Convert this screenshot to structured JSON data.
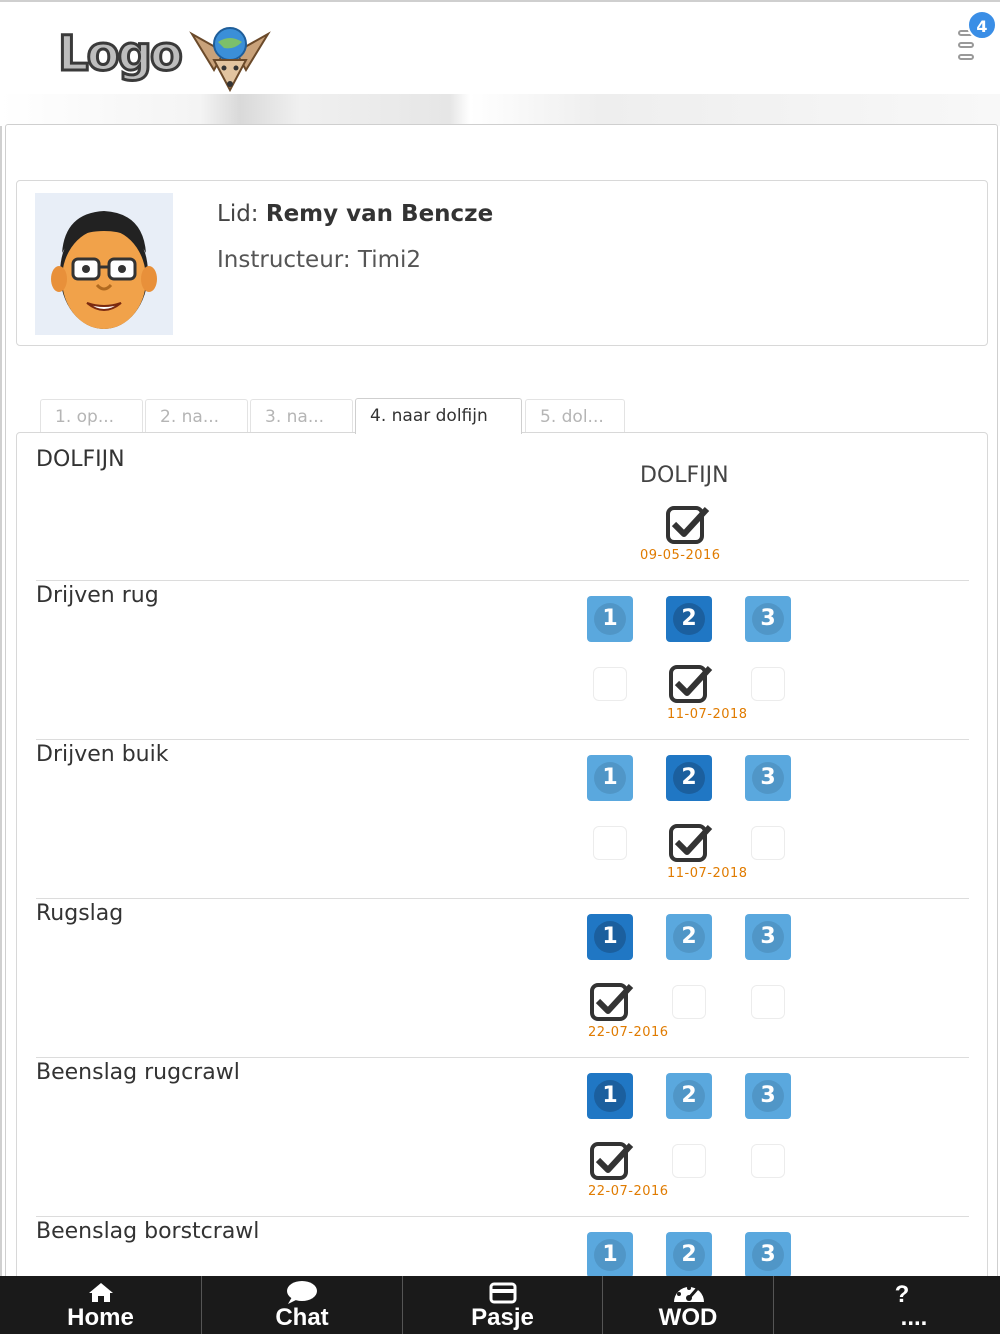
{
  "header": {
    "logo_text": "Logo",
    "menu_badge": "4"
  },
  "profile": {
    "lid_label": "Lid:",
    "lid_name": "Remy van Bencze",
    "instructeur_label": "Instructeur:",
    "instructeur_name": "Timi2"
  },
  "tabs": [
    {
      "label": "1. op..."
    },
    {
      "label": "2. na..."
    },
    {
      "label": "3. na..."
    },
    {
      "label": "4. naar dolfijn",
      "active": true
    },
    {
      "label": "5. dol..."
    }
  ],
  "diploma": {
    "title": "DOLFIJN",
    "column_label": "DOLFIJN",
    "date": "09-05-2016"
  },
  "skills": [
    {
      "name": "Drijven rug",
      "active_level": 2,
      "checked_level": 2,
      "date": "11-07-2018"
    },
    {
      "name": "Drijven buik",
      "active_level": 2,
      "checked_level": 2,
      "date": "11-07-2018"
    },
    {
      "name": "Rugslag",
      "active_level": 1,
      "checked_level": 1,
      "date": "22-07-2016"
    },
    {
      "name": "Beenslag rugcrawl",
      "active_level": 1,
      "checked_level": 1,
      "date": "22-07-2016"
    },
    {
      "name": "Beenslag borstcrawl",
      "active_level": 0,
      "checked_level": 0,
      "date": ""
    }
  ],
  "level_labels": [
    "1",
    "2",
    "3"
  ],
  "nav": [
    {
      "label": "Home",
      "icon": "home-icon"
    },
    {
      "label": "Chat",
      "icon": "chat-icon"
    },
    {
      "label": "Pasje",
      "icon": "card-icon"
    },
    {
      "label": "WOD",
      "icon": "dashboard-icon"
    },
    {
      "label": "....",
      "icon": "question-icon"
    }
  ],
  "colors": {
    "level": "#5aa8de",
    "level_active": "#2077c4",
    "date": "#e07b00",
    "badge": "#3a8ee6"
  }
}
